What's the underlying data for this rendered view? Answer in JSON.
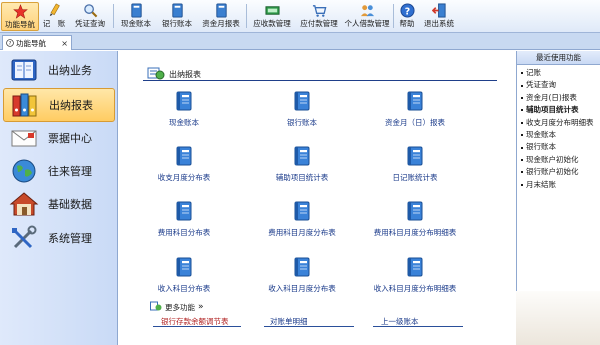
{
  "toolbar": {
    "items": [
      {
        "label": "功能导航",
        "icon": "star-icon"
      },
      {
        "label": "记　账",
        "icon": "pencil-icon"
      },
      {
        "label": "凭证查询",
        "icon": "magnifier-icon"
      },
      {
        "label": "现金账本",
        "icon": "cash-book-icon"
      },
      {
        "label": "银行账本",
        "icon": "bank-book-icon"
      },
      {
        "label": "资金月报表",
        "icon": "report-icon"
      },
      {
        "label": "应收款管理",
        "icon": "receivable-icon"
      },
      {
        "label": "应付款管理",
        "icon": "payable-icon"
      },
      {
        "label": "个人借款管理",
        "icon": "people-icon"
      },
      {
        "label": "帮助",
        "icon": "help-icon"
      },
      {
        "label": "退出系统",
        "icon": "exit-icon"
      }
    ]
  },
  "tab": {
    "label": "功能导航",
    "close": "×"
  },
  "sidebar": {
    "items": [
      {
        "label": "出纳业务",
        "icon": "book-icon"
      },
      {
        "label": "出纳报表",
        "icon": "binders-icon"
      },
      {
        "label": "票据中心",
        "icon": "envelope-icon"
      },
      {
        "label": "往来管理",
        "icon": "globe-icon"
      },
      {
        "label": "基础数据",
        "icon": "house-icon"
      },
      {
        "label": "系统管理",
        "icon": "tools-icon"
      }
    ]
  },
  "main": {
    "section_title": "出纳报表",
    "items": [
      {
        "label": "现金账本"
      },
      {
        "label": "银行账本"
      },
      {
        "label": "资金月（日）报表"
      },
      {
        "label": "收支月度分布表"
      },
      {
        "label": "辅助项目统计表"
      },
      {
        "label": "日记账统计表"
      },
      {
        "label": "费用科目分布表"
      },
      {
        "label": "费用科目月度分布表"
      },
      {
        "label": "费用科目月度分布明细表"
      },
      {
        "label": "收入科目分布表"
      },
      {
        "label": "收入科目月度分布表"
      },
      {
        "label": "收入科目月度分布明细表"
      }
    ],
    "more_label": "更多功能",
    "more_arrow": "»",
    "quick_links": [
      {
        "label": "银行存款余额调节表"
      },
      {
        "label": "对账单明细"
      },
      {
        "label": "上一级账本"
      }
    ]
  },
  "right_panel": {
    "title": "最近使用功能",
    "items": [
      {
        "label": "记账"
      },
      {
        "label": "凭证查询"
      },
      {
        "label": "资金月(日)报表"
      },
      {
        "label": "辅助项目统计表"
      },
      {
        "label": "收支月度分布明细表"
      },
      {
        "label": "现金账本"
      },
      {
        "label": "银行账本"
      },
      {
        "label": "现金账户初始化"
      },
      {
        "label": "银行账户初始化"
      },
      {
        "label": "月末结账"
      }
    ]
  }
}
